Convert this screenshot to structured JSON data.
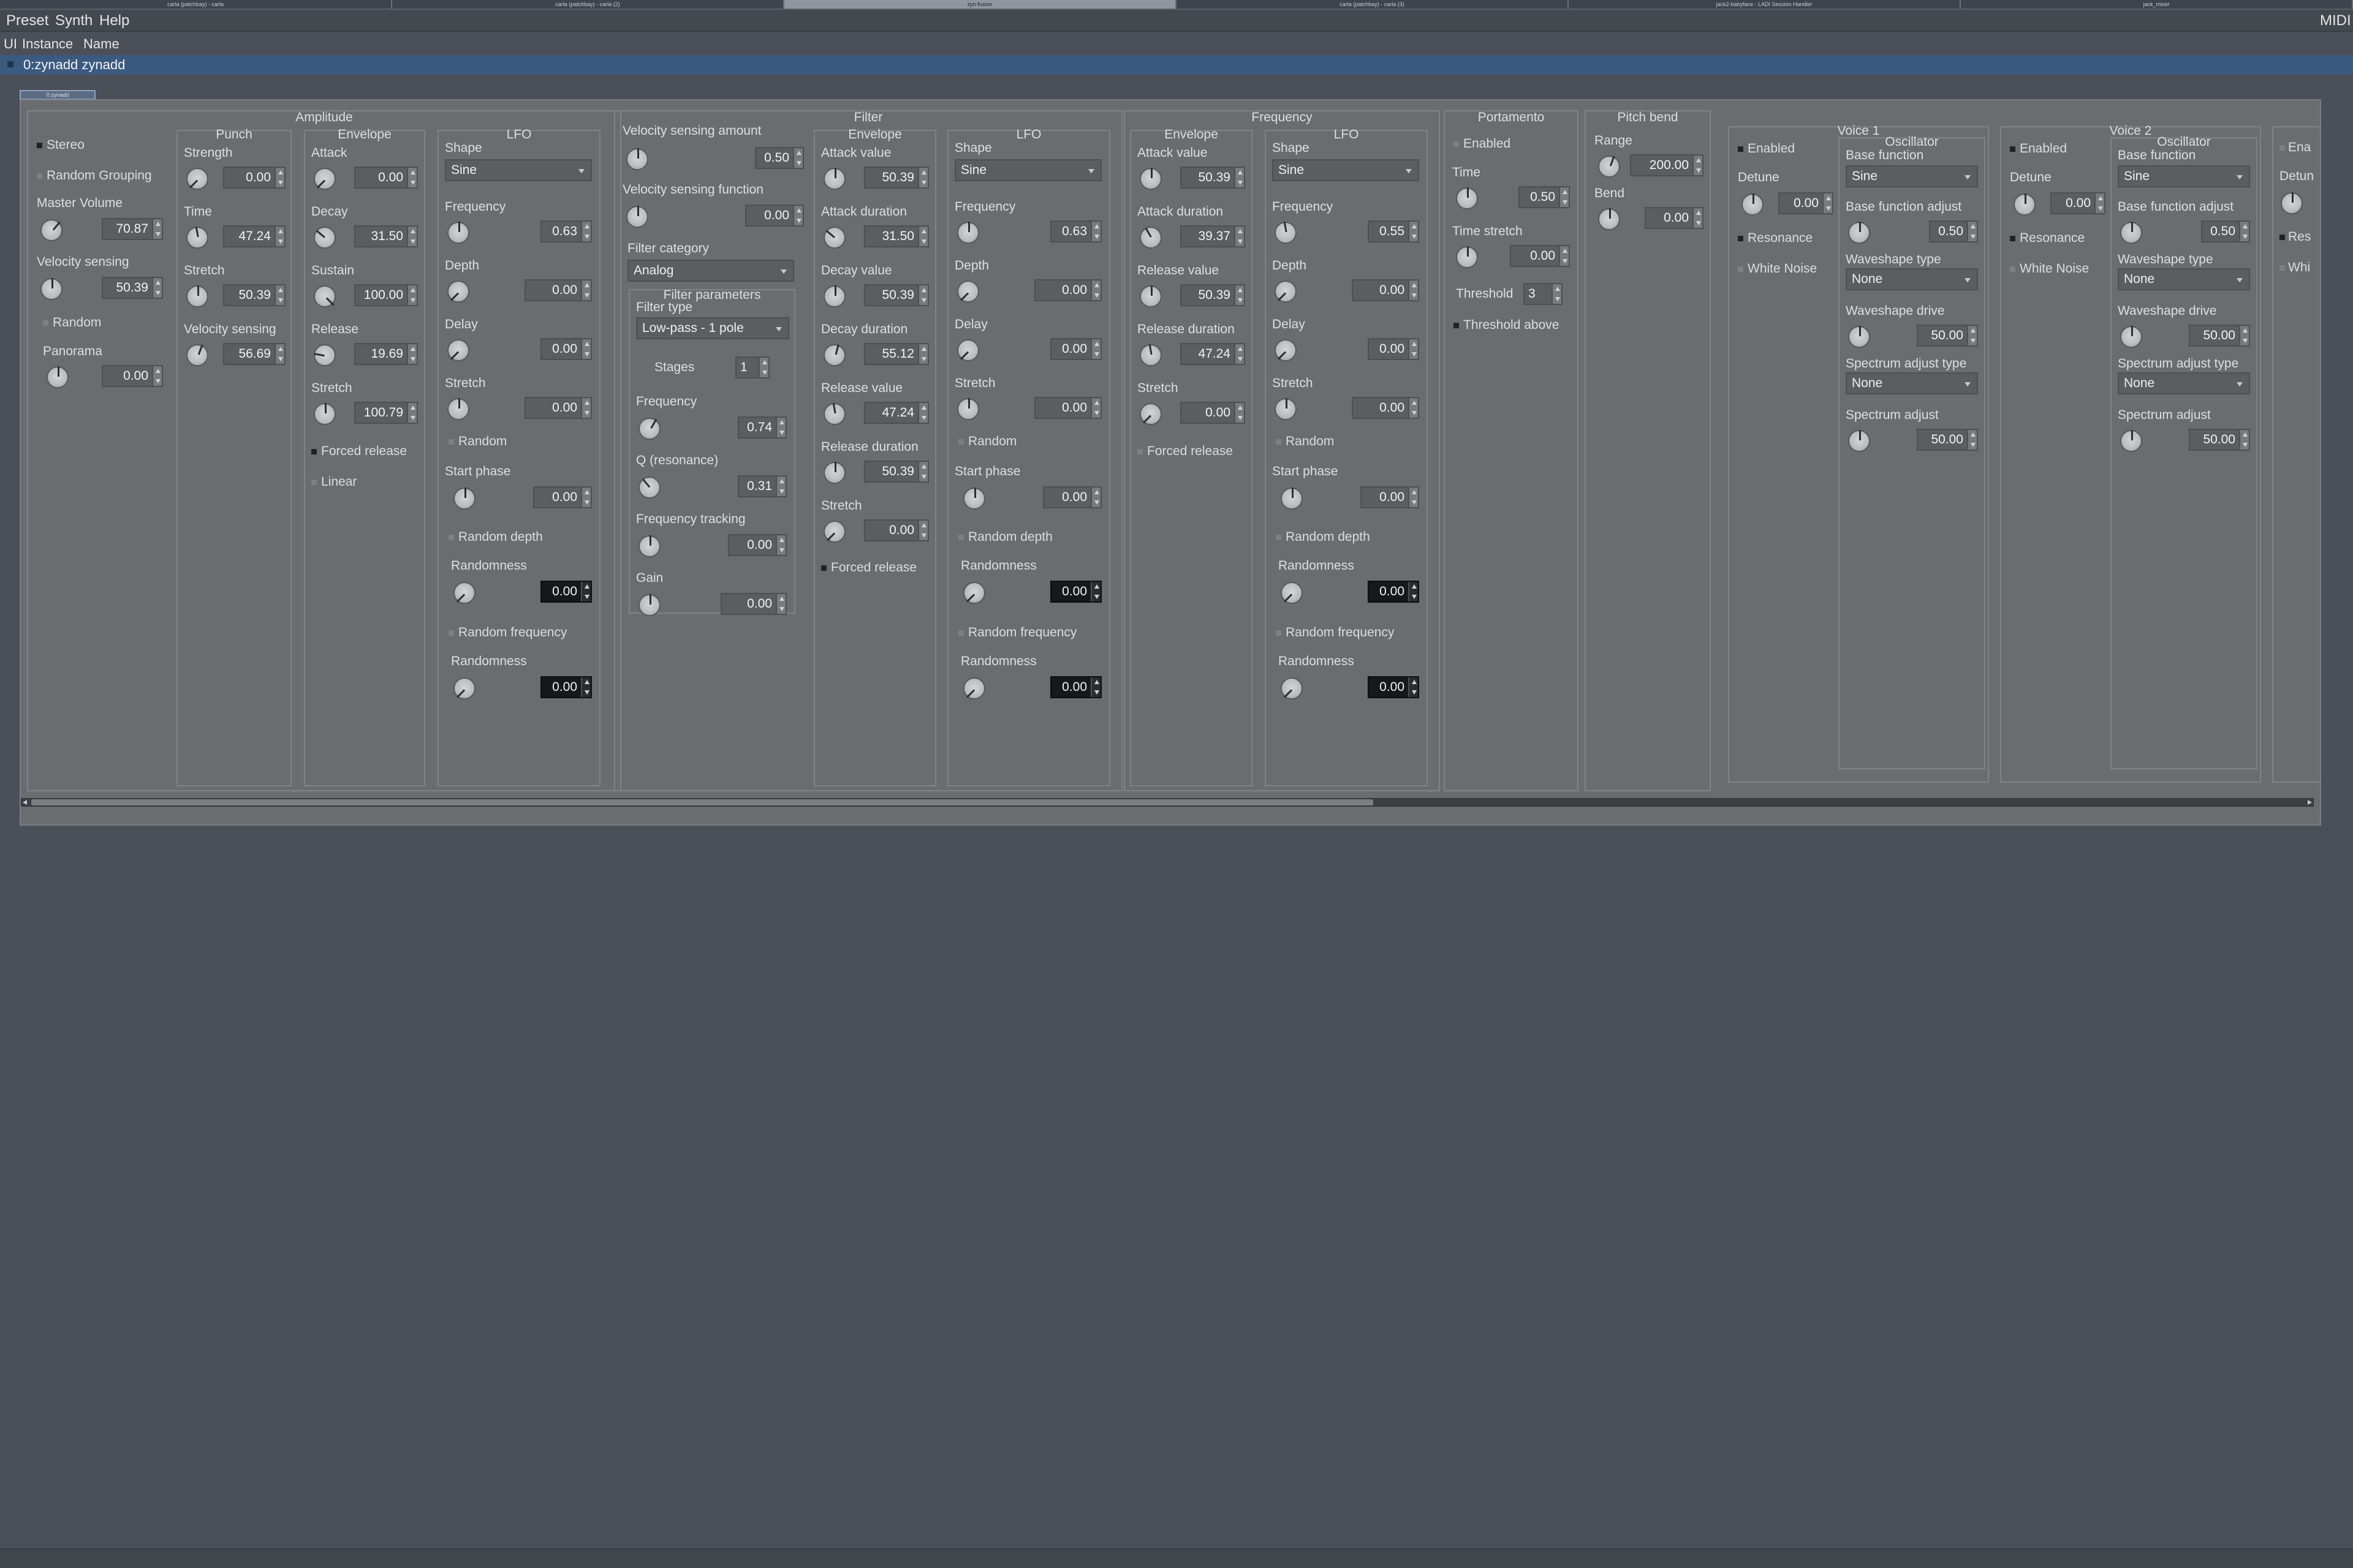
{
  "taskbar": {
    "tabs": [
      "carla (patchbay) - carla",
      "carla (patchbay) - carla (2)",
      "zyn-fusion",
      "carla (patchbay) - carla (3)",
      "jack2-babyface - LADI Session Handler",
      "jack_mixer"
    ]
  },
  "menu": {
    "preset": "Preset",
    "synth": "Synth",
    "help": "Help",
    "midi": "MIDI"
  },
  "columns": {
    "ui": "UI",
    "instance": "Instance",
    "name": "Name"
  },
  "instance": {
    "label": "0:zynadd zynadd"
  },
  "subtab": {
    "label": "0:zynadd"
  },
  "sections": {
    "amplitude": "Amplitude",
    "filter": "Filter",
    "frequency": "Frequency",
    "portamento": "Portamento",
    "pitch_bend": "Pitch bend",
    "voice1": "Voice 1",
    "voice2": "Voice 2",
    "punch": "Punch",
    "envelope": "Envelope",
    "lfo": "LFO",
    "oscillator": "Oscillator",
    "filter_params": "Filter parameters"
  },
  "labels": {
    "stereo": "Stereo",
    "random_grouping": "Random Grouping",
    "master_volume": "Master Volume",
    "velocity_sensing": "Velocity sensing",
    "random": "Random",
    "panorama": "Panorama",
    "strength": "Strength",
    "time": "Time",
    "stretch": "Stretch",
    "attack": "Attack",
    "decay": "Decay",
    "sustain": "Sustain",
    "release": "Release",
    "forced_release": "Forced release",
    "linear": "Linear",
    "shape": "Shape",
    "frequency": "Frequency",
    "depth": "Depth",
    "delay": "Delay",
    "start_phase": "Start phase",
    "random_depth": "Random depth",
    "randomness": "Randomness",
    "random_frequency": "Random frequency",
    "vel_sens_amount": "Velocity sensing amount",
    "vel_sens_function": "Velocity sensing function",
    "filter_category": "Filter category",
    "filter_type": "Filter type",
    "stages": "Stages",
    "q_res": "Q (resonance)",
    "freq_tracking": "Frequency tracking",
    "gain": "Gain",
    "attack_value": "Attack value",
    "attack_duration": "Attack duration",
    "decay_value": "Decay value",
    "decay_duration": "Decay duration",
    "release_value": "Release value",
    "release_duration": "Release duration",
    "enabled": "Enabled",
    "time_stretch": "Time stretch",
    "threshold": "Threshold",
    "threshold_above": "Threshold above",
    "range": "Range",
    "bend": "Bend",
    "detune": "Detune",
    "resonance": "Resonance",
    "white_noise": "White Noise",
    "base_function": "Base function",
    "base_function_adjust": "Base function adjust",
    "waveshape_type": "Waveshape type",
    "waveshape_drive": "Waveshape drive",
    "spectrum_adjust_type": "Spectrum adjust type",
    "spectrum_adjust": "Spectrum adjust",
    "ena_cut": "Ena",
    "detu_cut": "Detun",
    "res_cut": "Res",
    "whi_cut": "Whi"
  },
  "options": {
    "sine": "Sine",
    "analog": "Analog",
    "lowpass1": "Low-pass - 1 pole",
    "none": "None"
  },
  "values": {
    "amp_master_volume": "70.87",
    "amp_vel_sens": "50.39",
    "amp_panorama": "0.00",
    "punch_strength": "0.00",
    "punch_time": "47.24",
    "punch_stretch": "50.39",
    "punch_vel_sens": "56.69",
    "amp_env_attack": "0.00",
    "amp_env_decay": "31.50",
    "amp_env_sustain": "100.00",
    "amp_env_release": "19.69",
    "amp_env_stretch": "100.79",
    "amp_lfo_freq": "0.63",
    "amp_lfo_depth": "0.00",
    "amp_lfo_delay": "0.00",
    "amp_lfo_stretch": "0.00",
    "amp_lfo_start_phase": "0.00",
    "amp_lfo_randomness1": "0.00",
    "amp_lfo_randomness2": "0.00",
    "flt_vel_amount": "0.50",
    "flt_vel_function": "0.00",
    "flt_stages": "1",
    "flt_freq": "0.74",
    "flt_q": "0.31",
    "flt_freq_tracking": "0.00",
    "flt_gain": "0.00",
    "flt_env_attack_value": "50.39",
    "flt_env_attack_duration": "31.50",
    "flt_env_decay_value": "50.39",
    "flt_env_decay_duration": "55.12",
    "flt_env_release_value": "47.24",
    "flt_env_release_duration": "50.39",
    "flt_env_stretch": "0.00",
    "flt_lfo_freq": "0.63",
    "flt_lfo_depth": "0.00",
    "flt_lfo_delay": "0.00",
    "flt_lfo_stretch": "0.00",
    "flt_lfo_start_phase": "0.00",
    "flt_lfo_randomness1": "0.00",
    "flt_lfo_randomness2": "0.00",
    "frq_env_attack_value": "50.39",
    "frq_env_attack_duration": "39.37",
    "frq_env_release_value": "50.39",
    "frq_env_release_duration": "47.24",
    "frq_env_stretch": "0.00",
    "frq_lfo_freq": "0.55",
    "frq_lfo_depth": "0.00",
    "frq_lfo_delay": "0.00",
    "frq_lfo_stretch": "0.00",
    "frq_lfo_start_phase": "0.00",
    "frq_lfo_randomness1": "0.00",
    "frq_lfo_randomness2": "0.00",
    "port_time": "0.50",
    "port_time_stretch": "0.00",
    "port_threshold": "3",
    "pb_range": "200.00",
    "pb_bend": "0.00",
    "v1_detune": "0.00",
    "v1_bf_adjust": "0.50",
    "v1_ws_drive": "50.00",
    "v1_spec_adjust": "50.00",
    "v2_detune": "0.00",
    "v2_bf_adjust": "0.50",
    "v2_ws_drive": "50.00",
    "v2_spec_adjust": "50.00"
  }
}
